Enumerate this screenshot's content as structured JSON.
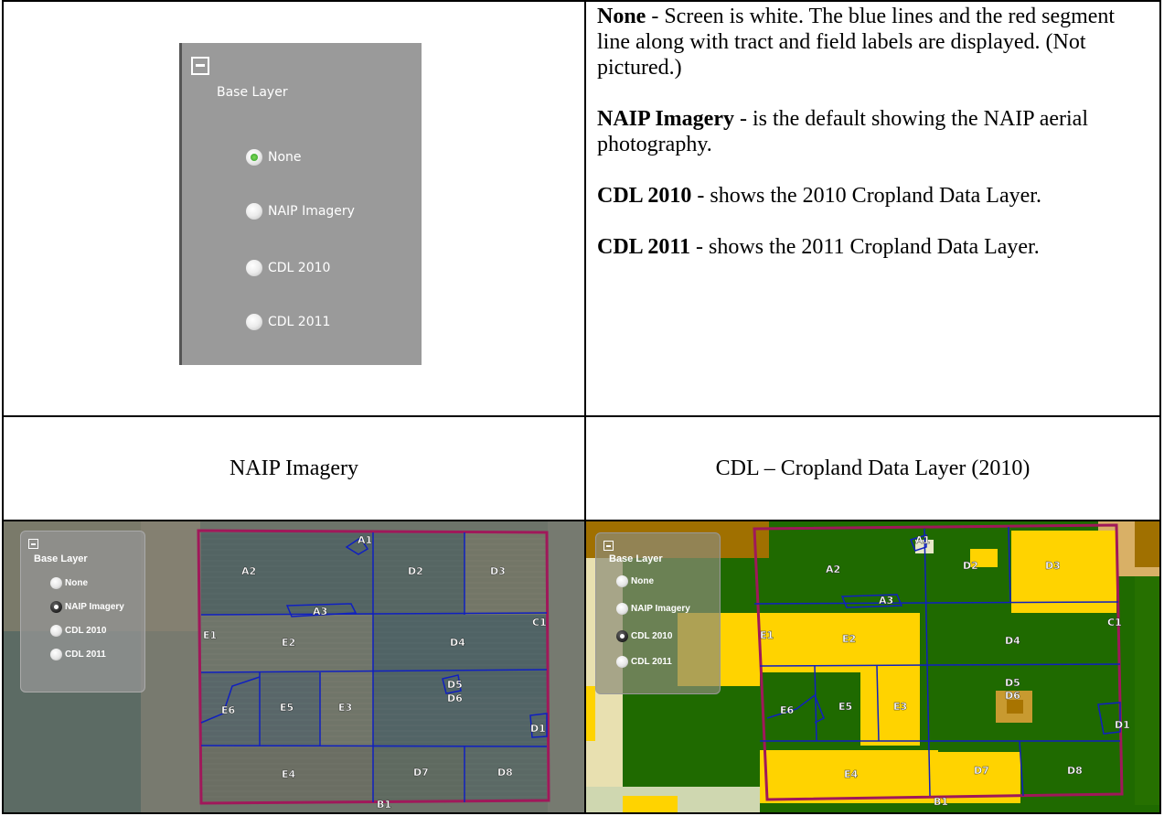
{
  "base_layer_panel": {
    "title": "Base Layer",
    "options": [
      "None",
      "NAIP Imagery",
      "CDL 2010",
      "CDL 2011"
    ],
    "selected": "None"
  },
  "descriptions": [
    {
      "term": "None",
      "text": " - Screen is white.  The blue lines and the red segment line along with tract and field labels are displayed. (Not pictured.)"
    },
    {
      "term": "NAIP Imagery",
      "text": " - is the default showing the NAIP aerial photography."
    },
    {
      "term": "CDL 2010",
      "text": " - shows the 2010 Cropland Data Layer."
    },
    {
      "term": "CDL 2011",
      "text": " - shows the 2011 Cropland Data Layer."
    }
  ],
  "captions": {
    "left": "NAIP Imagery",
    "right": "CDL – Cropland Data Layer (2010)"
  },
  "naip_map": {
    "panel_title": "Base Layer",
    "options": [
      "None",
      "NAIP Imagery",
      "CDL 2010",
      "CDL 2011"
    ],
    "selected": "NAIP Imagery",
    "field_labels": [
      "A1",
      "A2",
      "A3",
      "D2",
      "D3",
      "C1",
      "E1",
      "E2",
      "D4",
      "D5",
      "D6",
      "E6",
      "E5",
      "E3",
      "D1",
      "E4",
      "D7",
      "D8",
      "B1"
    ]
  },
  "cdl_map": {
    "panel_title": "Base Layer",
    "options": [
      "None",
      "NAIP Imagery",
      "CDL 2010",
      "CDL 2011"
    ],
    "selected": "CDL 2010",
    "field_labels": [
      "A1",
      "A2",
      "A3",
      "D2",
      "D3",
      "C1",
      "E1",
      "E2",
      "D4",
      "D5",
      "D6",
      "E6",
      "E5",
      "E3",
      "D1",
      "E4",
      "D7",
      "D8",
      "B1"
    ]
  },
  "colors": {
    "segment_line": "#a0185a",
    "field_lines": "#1020c0",
    "cdl_corn": "#ffd300",
    "cdl_soy": "#267000",
    "panel_gray": "#9a9a9a"
  }
}
